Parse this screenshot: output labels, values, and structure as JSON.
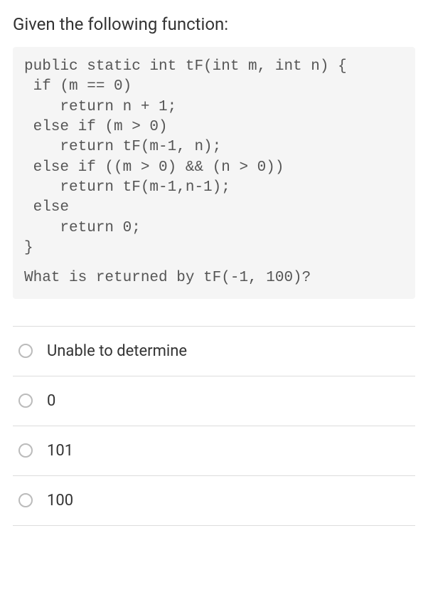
{
  "prompt": "Given the following function:",
  "code": "public static int tF(int m, int n) {\n if (m == 0)\n    return n + 1;\n else if (m > 0)\n    return tF(m-1, n);\n else if ((m > 0) && (n > 0))\n    return tF(m-1,n-1);\n else\n    return 0;\n}",
  "code_question": "What is returned by tF(-1, 100)?",
  "options": [
    {
      "label": "Unable to determine"
    },
    {
      "label": "0"
    },
    {
      "label": "101"
    },
    {
      "label": "100"
    }
  ]
}
